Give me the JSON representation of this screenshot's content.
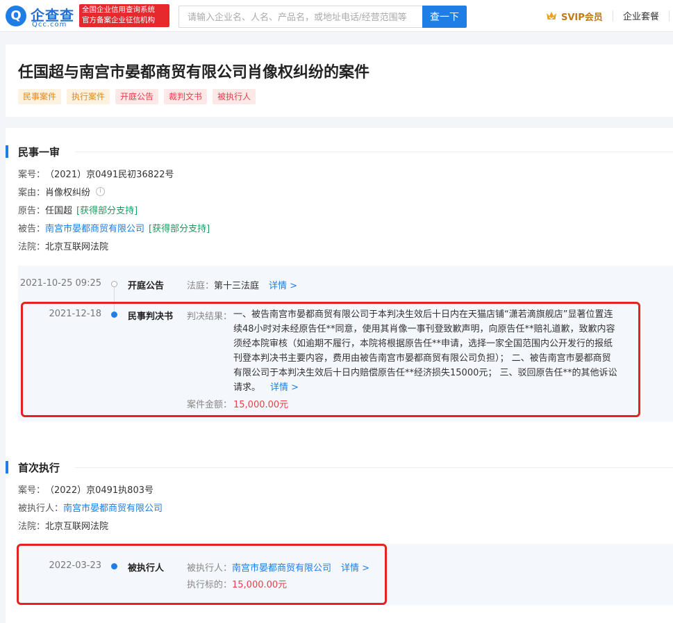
{
  "header": {
    "logo_cn": "企查查",
    "logo_en": "Qcc.com",
    "badge_line1": "全国企业信用查询系统",
    "badge_line2": "官方备案企业征信机构",
    "search_placeholder": "请输入企业名、人名、产品名，或地址电话/经营范围等",
    "search_button": "查一下",
    "svip": "SVIP会员",
    "package": "企业套餐"
  },
  "case": {
    "title": "任国超与南宫市晏都商贸有限公司肖像权纠纷的案件",
    "tags": [
      "民事案件",
      "执行案件",
      "开庭公告",
      "裁判文书",
      "被执行人"
    ]
  },
  "first_trial": {
    "section_title": "民事一审",
    "case_no_label": "案号：",
    "case_no": "（2021）京0491民初36822号",
    "cause_label": "案由：",
    "cause": "肖像权纠纷",
    "plaintiff_label": "原告：",
    "plaintiff": "任国超",
    "plaintiff_note": "[获得部分支持]",
    "defendant_label": "被告：",
    "defendant": "南宫市晏都商贸有限公司",
    "defendant_note": "[获得部分支持]",
    "court_label": "法院：",
    "court": "北京互联网法院",
    "events": [
      {
        "date": "2021-10-25 09:25",
        "type": "开庭公告",
        "label": "法庭：",
        "value": "第十三法庭",
        "detail": "详情 >"
      },
      {
        "date": "2021-12-18",
        "type": "民事判决书",
        "label": "判决结果：",
        "value": "一、被告南宫市晏都商贸有限公司于本判决生效后十日内在天猫店铺“潇若滴旗舰店”显著位置连续48小时对未经原告任**同意，使用其肖像一事刊登致歉声明，向原告任**赔礼道歉，致歉内容须经本院审核（如逾期不履行，本院将根据原告任**申请，选择一家全国范围内公开发行的报纸刊登本判决书主要内容，费用由被告南宫市晏都商贸有限公司负担）；  二、被告南宫市晏都商贸有限公司于本判决生效后十日内赔偿原告任**经济损失15000元；  三、驳回原告任**的其他诉讼请求。",
        "detail": "详情 >",
        "amount_label": "案件金额：",
        "amount": "15,000.00元"
      }
    ]
  },
  "first_execution": {
    "section_title": "首次执行",
    "case_no_label": "案号：",
    "case_no": "（2022）京0491执803号",
    "executed_label": "被执行人：",
    "executed": "南宫市晏都商贸有限公司",
    "court_label": "法院：",
    "court": "北京互联网法院",
    "event": {
      "date": "2022-03-23",
      "type": "被执行人",
      "label": "被执行人：",
      "value": "南宫市晏都商贸有限公司",
      "detail": "详情 >",
      "amount_label": "执行标的：",
      "amount": "15,000.00元"
    }
  },
  "colors": {
    "accent": "#1f7ee6",
    "money": "#e5404a",
    "highlight_box": "#e32222",
    "support_note": "#1a9b5e"
  }
}
